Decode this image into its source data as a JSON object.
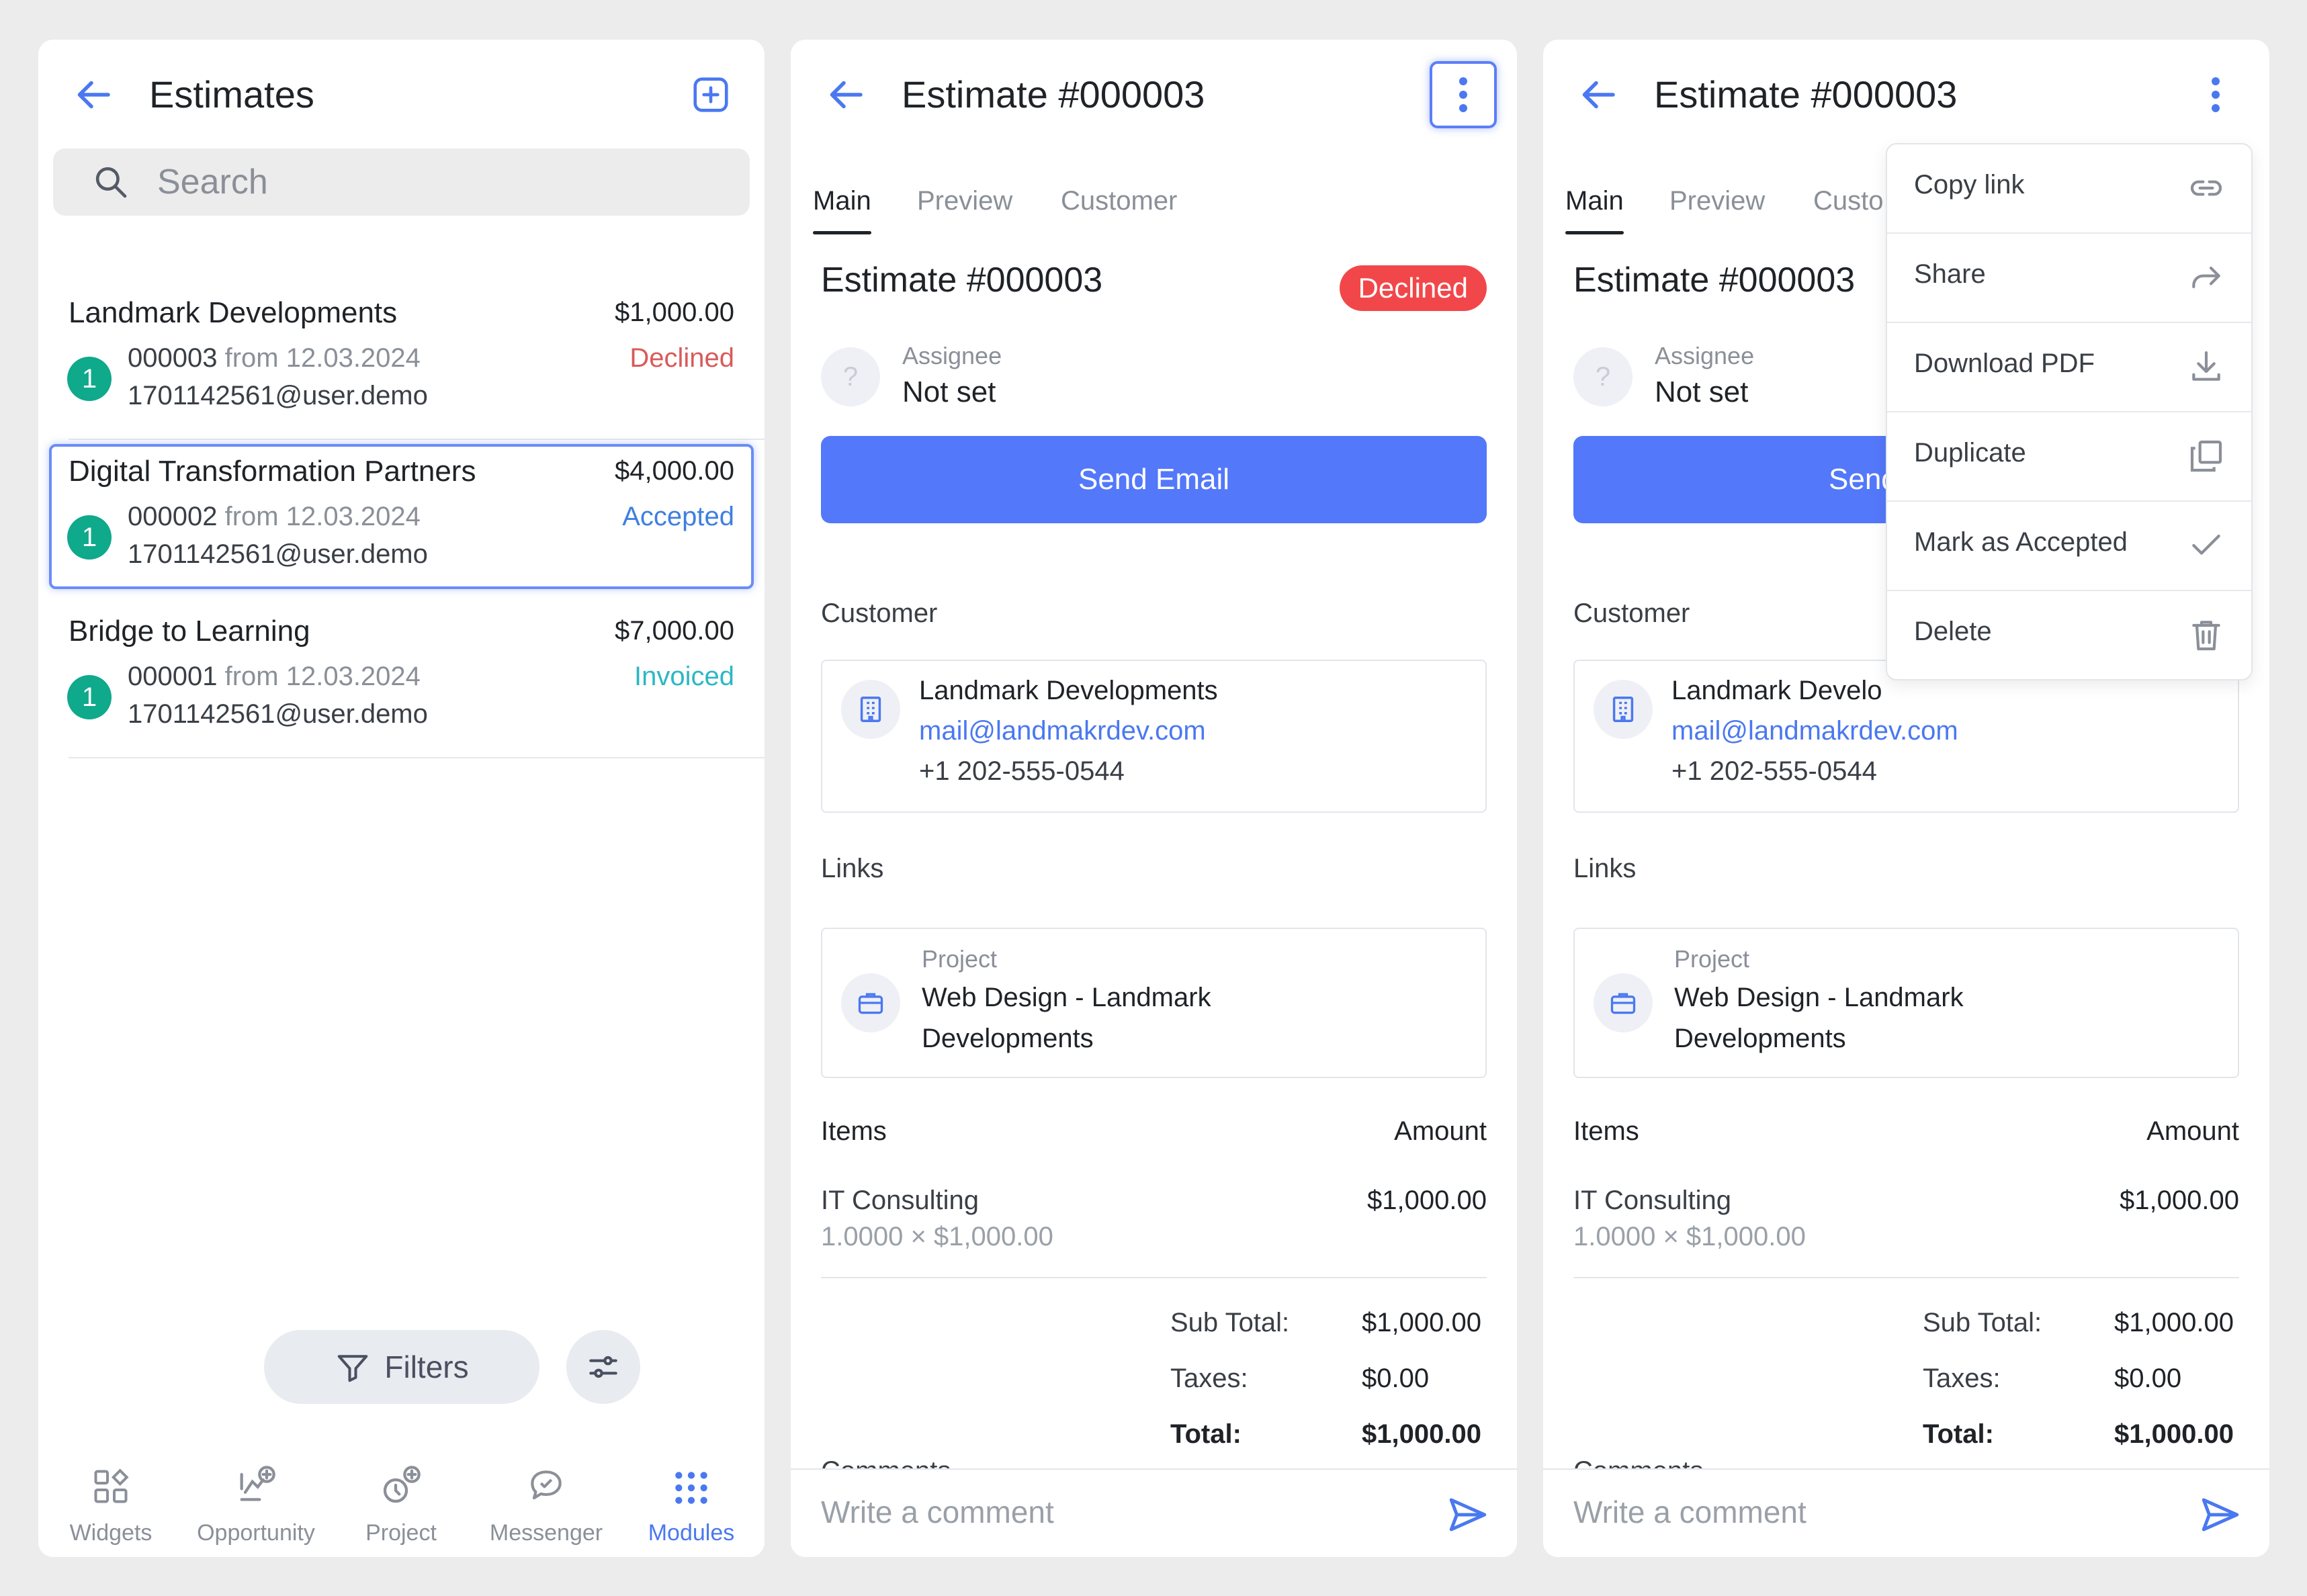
{
  "list": {
    "title": "Estimates",
    "search_placeholder": "Search",
    "rows": [
      {
        "name": "Landmark Developments",
        "amount": "$1,000.00",
        "badge": "1",
        "number": "000003",
        "from": "from 12.03.2024",
        "email": "1701142561@user.demo",
        "status": "Declined",
        "status_color": "#d95a5a"
      },
      {
        "name": "Digital Transformation Partners",
        "amount": "$4,000.00",
        "badge": "1",
        "number": "000002",
        "from": "from 12.03.2024",
        "email": "1701142561@user.demo",
        "status": "Accepted",
        "status_color": "#3f7fe0"
      },
      {
        "name": "Bridge to Learning",
        "amount": "$7,000.00",
        "badge": "1",
        "number": "000001",
        "from": "from 12.03.2024",
        "email": "1701142561@user.demo",
        "status": "Invoiced",
        "status_color": "#2db7c4"
      }
    ],
    "filters_label": "Filters",
    "nav": [
      {
        "label": "Widgets",
        "icon": "widgets-icon"
      },
      {
        "label": "Opportunity",
        "icon": "opportunity-icon"
      },
      {
        "label": "Project",
        "icon": "project-icon"
      },
      {
        "label": "Messenger",
        "icon": "messenger-icon"
      },
      {
        "label": "Modules",
        "icon": "modules-icon",
        "active": true
      }
    ]
  },
  "detail": {
    "title": "Estimate #000003",
    "tabs": [
      "Main",
      "Preview",
      "Customer"
    ],
    "estimate_title": "Estimate #000003",
    "status": "Declined",
    "assignee_label": "Assignee",
    "assignee_value": "Not set",
    "assignee_avatar": "?",
    "send_email": "Send Email",
    "customer_section": "Customer",
    "customer": {
      "name": "Landmark Developments",
      "email": "mail@landmakrdev.com",
      "phone": "+1 202-555-0544"
    },
    "links_section": "Links",
    "project": {
      "label": "Project",
      "name": "Web Design - Landmark Developments"
    },
    "items_header": "Items",
    "amount_header": "Amount",
    "item": {
      "name": "IT Consulting",
      "qty": "1.0000 × $1,000.00",
      "amount": "$1,000.00"
    },
    "subtotal_label": "Sub Total:",
    "subtotal": "$1,000.00",
    "taxes_label": "Taxes:",
    "taxes": "$0.00",
    "total_label": "Total:",
    "total": "$1,000.00",
    "comments_peek": "Comments",
    "comment_placeholder": "Write a comment"
  },
  "overlay": {
    "tab_customer_clipped": "Custo",
    "customer_name_clipped": "Landmark Develo",
    "send_clipped": "Send",
    "menu": [
      {
        "label": "Copy link",
        "icon": "link-icon"
      },
      {
        "label": "Share",
        "icon": "share-icon"
      },
      {
        "label": "Download PDF",
        "icon": "download-icon"
      },
      {
        "label": "Duplicate",
        "icon": "duplicate-icon"
      },
      {
        "label": "Mark as Accepted",
        "icon": "check-icon"
      },
      {
        "label": "Delete",
        "icon": "trash-icon"
      }
    ]
  },
  "colors": {
    "accent": "#5378fa",
    "declined": "#f2474a",
    "badge": "#0fa98b",
    "link": "#4a78f0"
  }
}
